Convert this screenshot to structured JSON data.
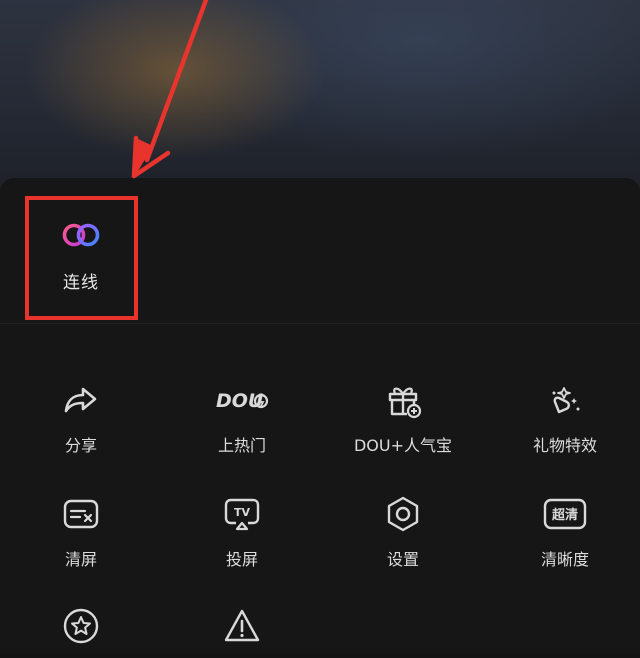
{
  "featured": {
    "label": "连线",
    "icon": "link-rings-icon"
  },
  "tools": [
    {
      "label": "分享",
      "icon": "share-arrow-icon"
    },
    {
      "label": "上热门",
      "icon": "dou-logo-icon",
      "logo_text": "DOU"
    },
    {
      "label": "DOU+人气宝",
      "icon": "gift-box-icon"
    },
    {
      "label": "礼物特效",
      "icon": "gift-effect-icon"
    },
    {
      "label": "清屏",
      "icon": "clear-screen-icon"
    },
    {
      "label": "投屏",
      "icon": "cast-screen-icon",
      "icon_text": "TV"
    },
    {
      "label": "设置",
      "icon": "settings-hex-icon"
    },
    {
      "label": "清晰度",
      "icon": "hd-quality-icon",
      "icon_text": "超清"
    },
    {
      "label": "",
      "icon": "star-circle-icon"
    },
    {
      "label": "",
      "icon": "warning-triangle-icon"
    }
  ],
  "colors": {
    "highlight": "#e8342d",
    "sheet_bg": "#161616",
    "icon_stroke": "#d9d9d9",
    "ring_pink": "#ff3d7f",
    "ring_blue": "#4d7dff"
  }
}
